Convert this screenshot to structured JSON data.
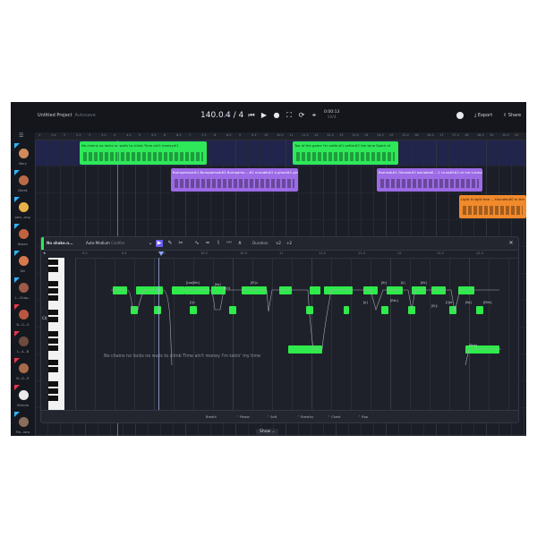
{
  "project": {
    "name": "Untitled Project",
    "status": "Autosave"
  },
  "transport": {
    "tempo": "140.0",
    "tempo_unit": "♩",
    "time_signature": "4 / 4",
    "time": "0:00:13",
    "bars": "10/4"
  },
  "actions": {
    "export": "Export",
    "share": "Share"
  },
  "ruler_ticks": [
    "1",
    "1.4",
    "2",
    "2.2",
    "3",
    "3.2",
    "4",
    "4.2",
    "5",
    "5.2",
    "6",
    "6.2",
    "7",
    "7.2",
    "8",
    "8.2",
    "9",
    "9.2",
    "10",
    "10.2",
    "11",
    "11.2",
    "12",
    "12.2",
    "13",
    "13.2",
    "14",
    "14.2",
    "15",
    "15.2",
    "16",
    "16.2",
    "17",
    "17.2",
    "18",
    "18.2",
    "19",
    "19.2",
    "20"
  ],
  "tracks": [
    {
      "name": "Mary",
      "color": "#2db4ff",
      "avatar": "#d08a5a"
    },
    {
      "name": "Derek",
      "color": "#2db4ff",
      "avatar": "#b86a48"
    },
    {
      "name": "Jam...eng",
      "color": "#2db4ff",
      "avatar": "#e7b24a"
    },
    {
      "name": "Bosen",
      "color": "#2db4ff",
      "avatar": "#c0633e"
    },
    {
      "name": "Gill",
      "color": "#2db4ff",
      "avatar": "#d5794d"
    },
    {
      "name": "L...Chap...",
      "color": "#2db4ff",
      "avatar": "#9c5a47"
    },
    {
      "name": "B...G...S",
      "color": "#e8344a",
      "avatar": "#b8573f"
    },
    {
      "name": "L...A...B",
      "color": "#e8344a",
      "avatar": "#6e4b3f"
    },
    {
      "name": "B...G...R",
      "color": "#e8344a",
      "avatar": "#a76a4a"
    },
    {
      "name": "Victoria",
      "color": "#e8344a",
      "avatar": "#eaeaea"
    },
    {
      "name": "Fle...ions",
      "color": "#2db4ff",
      "avatar": "#8a6d5a"
    }
  ],
  "clips": [
    {
      "text": "No chains no locks no walls to climb Time ain't money#1",
      "color": "#2ee85a",
      "textcolor": "#0d3314"
    },
    {
      "text": "Top of the game I'm settin#1 settin#2 the tone Spark of",
      "color": "#2ee85a",
      "textcolor": "#0d3314"
    },
    {
      "text": "Bumpamsok#1 Bumpamsok#2 Bumpamo... #1 murobit#2 a girsel#1 girsel#2",
      "color": "#9d6be6",
      "textcolor": "#ffffff"
    },
    {
      "text": "Bumsok#1 Gimsok#2 asinabedi... 1 crusstill#2 at me Lucas#1",
      "color": "#9d6be6",
      "textcolor": "#ffffff"
    },
    {
      "text": "Light it right free ... thunder#0 in the",
      "color": "#f08a2c",
      "textcolor": "#2a1605"
    }
  ],
  "piano_roll": {
    "track_label": "No shake.n...",
    "model": "Auto-Medium",
    "model_sub": "Coldfier",
    "key_label": "C4",
    "duration_label": "Duration",
    "duration_values": [
      "×2",
      "÷2"
    ],
    "ruler": [
      "9.2",
      "9.4",
      "10",
      "10.2",
      "10.4",
      "11",
      "11.2",
      "11.4",
      "12",
      "12.2",
      "12.4"
    ],
    "lyric_line": "No chains no locks no walls to climb Time ain't money I'm takin' my time",
    "note_labels": [
      "[Loa]Kkr]",
      "[Ei]u",
      "[i]n",
      "[Ko]",
      "[p]",
      "[Kr]",
      "[k]",
      "[Kk]",
      "[Ei]i",
      "[i]vk",
      "[Ka]",
      "[Eikk]",
      "[Kn]",
      "[Rlin]",
      "[Bhe]"
    ],
    "footer": [
      "Breath",
      "Power",
      "Soft",
      "Breathy",
      "Chest",
      "Rap"
    ]
  },
  "show_button": "Show"
}
